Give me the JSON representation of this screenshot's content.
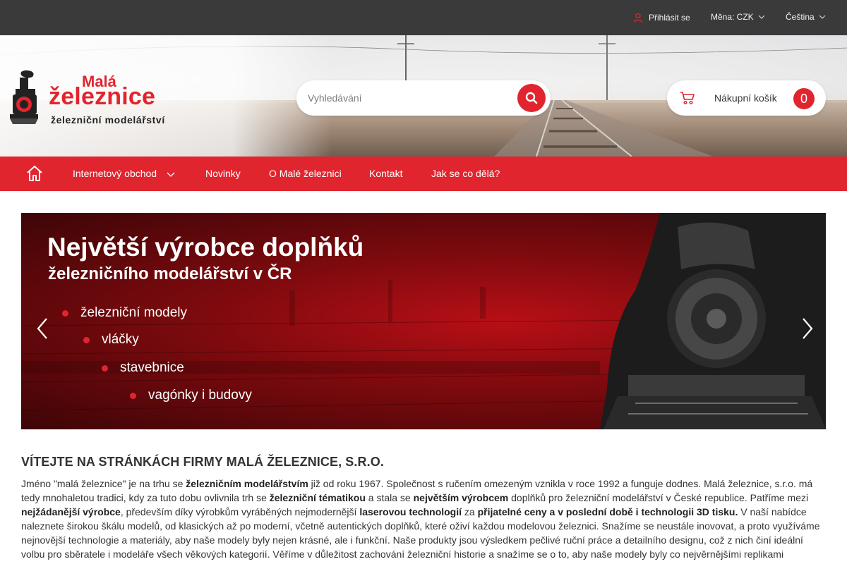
{
  "topbar": {
    "login": "Přihlásit se",
    "currency": "Měna: CZK",
    "language": "Čeština"
  },
  "logo": {
    "line1": "Malá",
    "line2": "železnice",
    "line3": "železniční modelářství"
  },
  "search": {
    "placeholder": "Vyhledávání"
  },
  "cart": {
    "label": "Nákupní košík",
    "count": "0"
  },
  "nav": {
    "items": [
      "Internetový obchod",
      "Novinky",
      "O Malé železnici",
      "Kontakt",
      "Jak se co dělá?"
    ]
  },
  "banner": {
    "title": "Největší výrobce doplňků",
    "subtitle": "železničního modelářství v ČR",
    "bullets": [
      "železniční modely",
      "vláčky",
      "stavebnice",
      "vagónky i budovy"
    ]
  },
  "content": {
    "heading": "VÍTEJTE NA STRÁNKÁCH FIRMY MALÁ ŽELEZNICE, S.R.O.",
    "p": [
      "Jméno \"malá železnice\" je na trhu se ",
      "železničním modelářstvím",
      " již od roku 1967. Společnost s ručením omezeným vznikla v roce 1992 a funguje dodnes. Malá železnice, s.r.o. má tedy mnohaletou tradici, kdy za tuto dobu ovlivnila trh se ",
      "železniční tématikou",
      " a stala se ",
      "největším výrobcem",
      " doplňků pro železniční modelářství v České republice. Patříme mezi ",
      "nejžádanější výrobce",
      ", především díky výrobkům vyráběných nejmodernější ",
      "laserovou technologií",
      " za ",
      "přijatelné ceny  a v poslední době i technologii 3D tisku.",
      " V naší nabídce naleznete širokou škálu modelů, od klasických až po moderní, včetně autentických doplňků, které oživí každou modelovou železnici. Snažíme se neustále inovovat, a proto využíváme nejnovější technologie a materiály, aby naše modely byly nejen krásné, ale i funkční. Naše produkty jsou výsledkem pečlivé ruční práce a detailního designu, což z nich činí ideální volbu pro sběratele i modeláře všech věkových kategorií. Věříme v důležitost zachování železniční historie a snažíme se o to, aby naše modely byly co nejvěrnějšími replikami"
    ]
  },
  "colors": {
    "accent": "#e1252f",
    "topbar": "#3a3a3a"
  }
}
